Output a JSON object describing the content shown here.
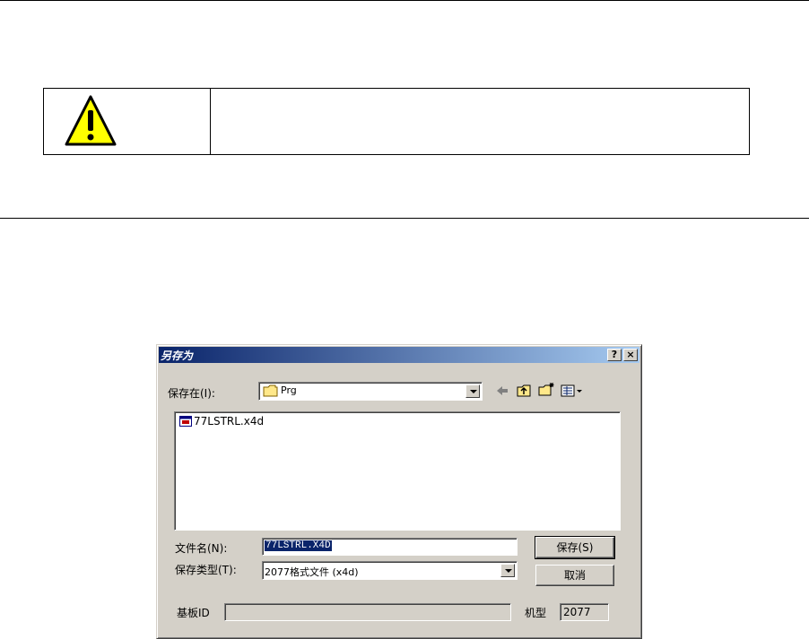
{
  "dialog": {
    "title": "另存为",
    "help_btn": "?",
    "close_btn": "×",
    "save_in_label": "保存在(I):",
    "save_in_value": "Prg",
    "files": [
      {
        "name": "77LSTRL.x4d"
      }
    ],
    "filename_label": "文件名(N):",
    "filename_value": "77LSTRL.X4D",
    "filetype_label": "保存类型(T):",
    "filetype_value": "2077格式文件 (x4d)",
    "save_button": "保存(S)",
    "cancel_button": "取消",
    "board_id_label": "基板ID",
    "board_id_value": "",
    "model_label": "机型",
    "model_value": "2077"
  },
  "icons": {
    "warning": "warning-triangle-icon",
    "folder": "folder-icon",
    "back": "back-arrow-icon",
    "up": "up-folder-icon",
    "new_folder": "new-folder-icon",
    "view": "view-menu-icon",
    "file": "file-icon"
  },
  "colors": {
    "title_start": "#0a246a",
    "title_end": "#a6caf0",
    "dialog_bg": "#d4d0c8",
    "warning_fill": "#ffff00"
  }
}
